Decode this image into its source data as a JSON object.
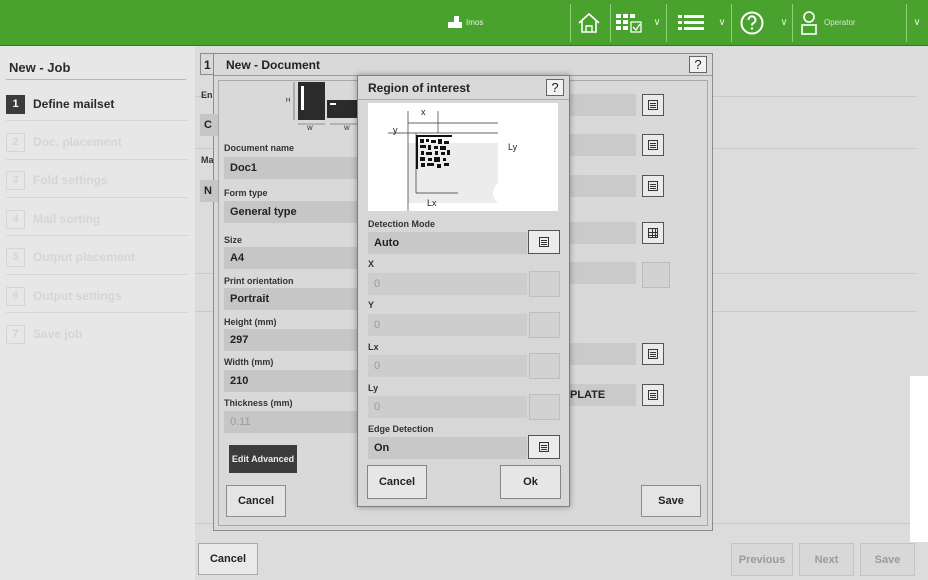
{
  "topbar": {
    "logo_text": "Imos",
    "user_label": "Operator",
    "icons": [
      "home-icon",
      "job-grid-icon",
      "list-menu-icon",
      "help-circle-icon",
      "user-icon"
    ],
    "bg_color": "#4aa22e"
  },
  "job_panel": {
    "title": "New - Job",
    "steps": [
      {
        "num": "1",
        "label": "Define mailset",
        "active": true
      },
      {
        "num": "2",
        "label": "Doc. placement",
        "active": false
      },
      {
        "num": "3",
        "label": "Fold settings",
        "active": false
      },
      {
        "num": "4",
        "label": "Mail sorting",
        "active": false
      },
      {
        "num": "5",
        "label": "Output placement",
        "active": false
      },
      {
        "num": "6",
        "label": "Output settings",
        "active": false
      },
      {
        "num": "7",
        "label": "Save job",
        "active": false
      }
    ]
  },
  "main": {
    "partial_labels": {
      "en": "En",
      "c": "C",
      "ma": "Ma",
      "n": "N"
    },
    "buttons": {
      "cancel": "Cancel",
      "previous": "Previous",
      "next": "Next",
      "save": "Save"
    }
  },
  "document_dialog": {
    "num": "1",
    "title": "New - Document",
    "help": "?",
    "diagram_labels": {
      "h": "H",
      "w1": "W",
      "w2": "W"
    },
    "fields": {
      "document_name": {
        "label": "Document name",
        "value": "Doc1"
      },
      "form_type": {
        "label": "Form type",
        "value": "General type"
      },
      "size": {
        "label": "Size",
        "value": "A4"
      },
      "print_orientation": {
        "label": "Print orientation",
        "value": "Portrait"
      },
      "height": {
        "label": "Height (mm)",
        "value": "297"
      },
      "width": {
        "label": "Width (mm)",
        "value": "210"
      },
      "thickness": {
        "label": "Thickness (mm)",
        "value": "0.11"
      }
    },
    "right_value": "PLATE",
    "buttons": {
      "edit_advanced": "Edit Advanced",
      "cancel": "Cancel",
      "save": "Save"
    }
  },
  "roi_dialog": {
    "title": "Region of interest",
    "help": "?",
    "diagram": {
      "x": "x",
      "y": "y",
      "lx": "Lx",
      "ly": "Ly"
    },
    "fields": {
      "detection_mode": {
        "label": "Detection Mode",
        "value": "Auto"
      },
      "x": {
        "label": "X",
        "value": "0"
      },
      "y": {
        "label": "Y",
        "value": "0"
      },
      "lx": {
        "label": "Lx",
        "value": "0"
      },
      "ly": {
        "label": "Ly",
        "value": "0"
      },
      "edge_detection": {
        "label": "Edge Detection",
        "value": "On"
      }
    },
    "buttons": {
      "cancel": "Cancel",
      "ok": "Ok"
    }
  }
}
